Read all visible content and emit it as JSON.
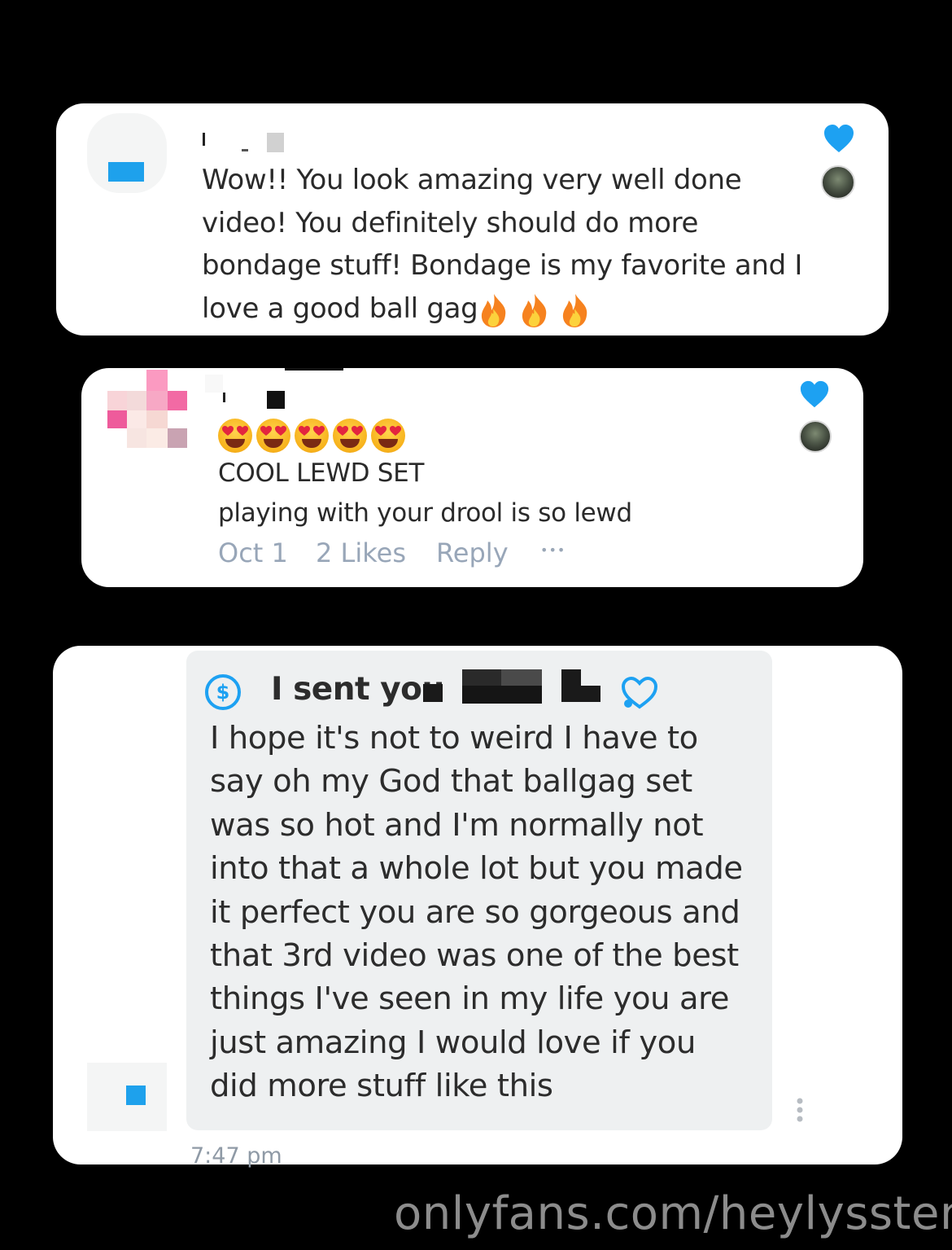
{
  "comments": [
    {
      "text": "Wow!! You look amazing very well done\nvideo! You definitely should do more\nbondage stuff! Bondage is my favorite and I\nlove a good ball gag",
      "emoji": [
        "fire-icon",
        "fire-icon",
        "fire-icon"
      ],
      "liked": true
    },
    {
      "emoji": [
        "heart-eyes-emoji",
        "heart-eyes-emoji",
        "heart-eyes-emoji",
        "heart-eyes-emoji",
        "heart-eyes-emoji"
      ],
      "line1": "COOL LEWD SET",
      "line2": "playing with your drool is so lewd",
      "date": "Oct 1",
      "likes": "2 Likes",
      "reply": "Reply",
      "more": "•••",
      "liked": true
    }
  ],
  "message": {
    "tip_text": "I sent you",
    "tip_icon": "dollar-circle-icon",
    "heart_icon": "heart-outline-icon",
    "text": "I hope it's not to weird I have to\nsay oh my God that ballgag set\nwas so hot and I'm normally not\ninto that a whole lot but you made\nit perfect you are so gorgeous and\nthat 3rd video was one of the best\nthings I've seen in my life you are\njust amazing I would love if you\ndid more stuff like this",
    "time": "7:47 pm"
  },
  "watermark": "onlyfans.com/heylyssten",
  "colors": {
    "accent_blue": "#1da1f2",
    "card_bg": "#ffffff",
    "bubble_bg": "#eef0f1",
    "page_bg": "#000000",
    "meta_text": "#98a6b8"
  }
}
